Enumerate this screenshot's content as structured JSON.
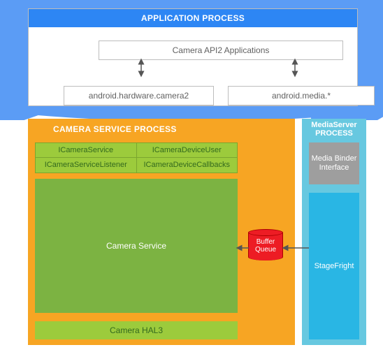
{
  "app_process": {
    "header": "APPLICATION PROCESS",
    "api_box": "Camera API2 Applications",
    "lib_left": "android.hardware.camera2",
    "lib_right": "android.media.*"
  },
  "camera_service_process": {
    "header": "CAMERA SERVICE PROCESS",
    "interfaces": {
      "r0c0": "ICameraService",
      "r0c1": "ICameraDeviceUser",
      "r1c0": "ICameraServiceListener",
      "r1c1": "ICameraDeviceCallbacks"
    },
    "service_box": "Camera Service",
    "hal_box": "Camera HAL3"
  },
  "media_server_process": {
    "header_line1": "MediaServer",
    "header_line2": "PROCESS",
    "binder_box": "Media Binder Interface",
    "stagefright_box": "StageFright"
  },
  "buffer_queue": {
    "line1": "Buffer",
    "line2": "Queue"
  },
  "colors": {
    "blue_header": "#2d86f4",
    "blue_band": "#5b9cf5",
    "orange": "#f7a523",
    "green_light": "#9ccb3c",
    "green_dark": "#7cb342",
    "cyan_light": "#67c8e0",
    "cyan_dark": "#29b6e4",
    "grey": "#9e9e9e",
    "red": "#ed1c24"
  }
}
